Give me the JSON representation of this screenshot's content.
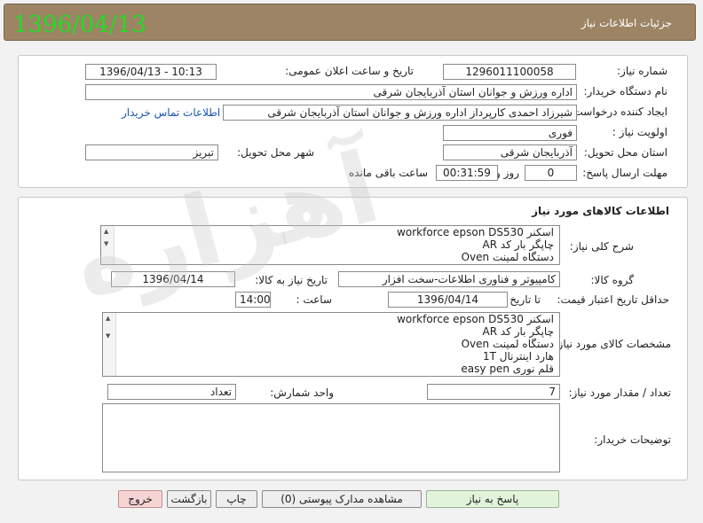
{
  "header": {
    "stamp_date": "1396/04/13",
    "title": "جزئیات اطلاعات نیاز"
  },
  "info": {
    "need_number_label": "شماره نیاز:",
    "need_number": "1296011100058",
    "announce_label": "تاریخ و ساعت اعلان عمومی:",
    "announce_value": "1396/04/13 - 10:13",
    "buyer_org_label": "نام دستگاه خریدار:",
    "buyer_org": "اداره ورزش و جوانان استان آذربایجان شرقی",
    "requester_label": "ایجاد کننده درخواست:",
    "requester": "شیرزاد احمدی کارپرداز اداره ورزش و جوانان استان آذربایجان شرقی",
    "contact_link": "اطلاعات تماس خریدار",
    "priority_label": "اولویت نیاز :",
    "priority": "فوری",
    "province_label": "استان محل تحویل:",
    "province": "آذربایجان شرقی",
    "city_label": "شهر محل تحویل:",
    "city": "تبریز",
    "deadline_label": "مهلت ارسال پاسخ:",
    "days": "0",
    "days_unit": "روز و",
    "time_left": "00:31:59",
    "time_left_unit": "ساعت باقی مانده"
  },
  "goods": {
    "section_title": "اطلاعات کالاهای مورد نیاز",
    "summary_label": "شرح کلی نیاز:",
    "summary_lines": [
      "اسکنر workforce epson DS530",
      "چاپگر بار کد AR",
      "دستگاه لمینت Oven"
    ],
    "group_label": "گروه کالا:",
    "group": "کامپیوتر و فناوری اطلاعات-سخت افزار",
    "need_date_label": "تاریخ نیاز به کالا:",
    "need_date": "1396/04/14",
    "validity_label": "حداقل تاریخ اعتبار قیمت:",
    "to_date_label": "تا تاریخ :",
    "validity_date": "1396/04/14",
    "time_label": "ساعت :",
    "validity_time": "14:00",
    "specs_label": "مشخصات کالای مورد نیاز:",
    "specs_lines": [
      "اسکنر workforce epson DS530",
      "چاپگر بار کد AR",
      "دستگاه لمینت Oven",
      "هارد اینترنال 1T",
      "قلم نوری easy pen"
    ],
    "qty_label": "تعداد / مقدار مورد نیاز:",
    "qty": "7",
    "unit_label": "واحد شمارش:",
    "unit": "تعداد",
    "buyer_notes_label": "توضیحات خریدار:",
    "buyer_notes": ""
  },
  "buttons": {
    "reply": "پاسخ به نیاز",
    "attachments": "مشاهده مدارک پیوستی (0)",
    "print": "چاپ",
    "back": "بازگشت",
    "exit": "خروج"
  },
  "colors": {
    "header_bg": "#9c8465",
    "stamp": "#22dd22",
    "link": "#1a56b0",
    "exit_bg": "#f7d4d4",
    "reply_bg": "#e2f3dc"
  }
}
